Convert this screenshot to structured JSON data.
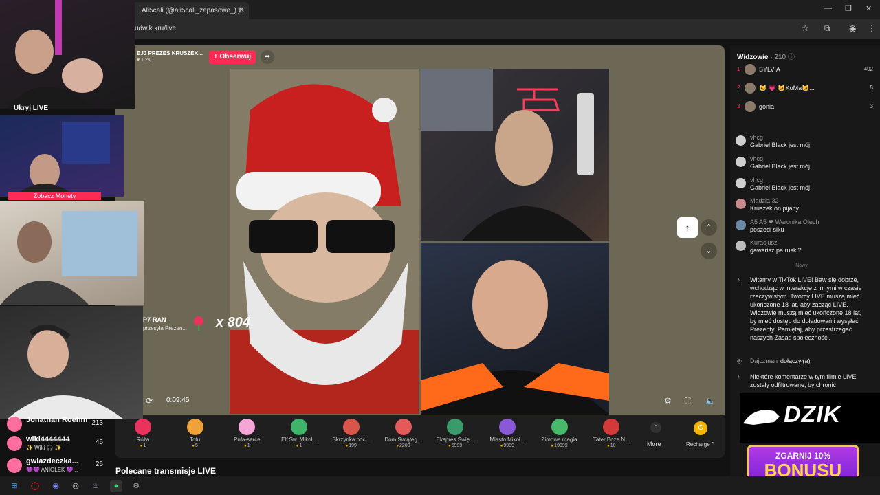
{
  "browser": {
    "tab_title": "Ali5cali (@ali5cali_zapasowe_) j",
    "url": "udwik.kru/live"
  },
  "stream": {
    "host_name": "EJJ PREZES KRUSZEK...",
    "host_likes": "♥ 1.2K",
    "follow_label": "+ Obserwuj",
    "time": "0:09:45",
    "gift_sender": "P7-RAN",
    "gift_sender_sub": "przesyła Prezen...",
    "gift_multiplier": "x 804"
  },
  "gifts": [
    {
      "label": "Róża",
      "price": "1",
      "color": "#e8335c"
    },
    {
      "label": "Tofu",
      "price": "5",
      "color": "#f0a23a"
    },
    {
      "label": "Pufa-serce",
      "price": "1",
      "color": "#f6a6d6"
    },
    {
      "label": "Elf Św. Mikoł...",
      "price": "1",
      "color": "#3fb36a"
    },
    {
      "label": "Skrzynka poc...",
      "price": "199",
      "color": "#d8554a"
    },
    {
      "label": "Dom Świąteg...",
      "price": "2200",
      "color": "#e45a5a"
    },
    {
      "label": "Ekspres Świę...",
      "price": "5999",
      "color": "#3a9a6a"
    },
    {
      "label": "Miasto Mikoł...",
      "price": "9999",
      "color": "#8a5ad6"
    },
    {
      "label": "Zimowa magia",
      "price": "19999",
      "color": "#4ab86a"
    },
    {
      "label": "Tater Boże N...",
      "price": "10",
      "color": "#d23a3a"
    }
  ],
  "gift_more": "More",
  "recharge_label": "Recharge ^",
  "recommended_title": "Polecane transmisje LIVE",
  "viewers": {
    "title": "Widzowie",
    "count": "· 210",
    "top": [
      {
        "rank": "1",
        "name": "SYLVIA",
        "score": "402"
      },
      {
        "rank": "2",
        "name": "🐱 💗 🐱KoMa🐱...",
        "score": "5"
      },
      {
        "rank": "3",
        "name": "gonia",
        "score": "3"
      }
    ]
  },
  "chat": [
    {
      "user": "vhcg",
      "msg": "Gabriel Black jest mój",
      "color": "#cfcfcf"
    },
    {
      "user": "vhcg",
      "msg": "Gabriel Black jest mój",
      "color": "#cfcfcf"
    },
    {
      "user": "vhcg",
      "msg": "Gabriel Black jest mój",
      "color": "#cfcfcf"
    },
    {
      "user": "Madzia 32",
      "msg": "Kruszek on pijany",
      "color": "#c88a8a"
    },
    {
      "user": "A5 A5 ❤ Weronika Olech",
      "msg": "poszedł siku",
      "color": "#6a8aa6"
    },
    {
      "user": "Kuracjusz",
      "msg": "gawarisz pa ruski?",
      "color": "#bdbdbd"
    }
  ],
  "divider_new": "Nowy",
  "system_msg_1": "Witamy w TikTok LIVE! Baw się dobrze, wchodząc w interakcje z innymi w czasie rzeczywistym. Twórcy LIVE muszą mieć ukończone 18 lat, aby zacząć LIVE. Widzowie muszą mieć ukończone 18 lat, by mieć dostęp do doładowań i wysyłać Prezenty. Pamiętaj, aby przestrzegać naszych Zasad społeczności.",
  "join": {
    "user": "Dajczman",
    "action": "dołączył(a)"
  },
  "system_msg_2": "Niektóre komentarze w tym filmie LIVE zostały odfiltrowane, by chronić",
  "ads": {
    "dzik": "DZIK",
    "bonus_line1": "ZGARNIJ 10%",
    "bonus_line2": "BONUSU"
  },
  "overlay": {
    "hide_live": "Ukryj LIVE",
    "zobacz": "Zobacz Monety",
    "leaderboard": [
      {
        "name": "Jonathan Roehm",
        "sub": "",
        "count": "213"
      },
      {
        "name": "wiki4444444",
        "sub": "✨ Wiki 🎧 ✨",
        "count": "45"
      },
      {
        "name": "gwiazdeczka...",
        "sub": "💜💜 ANIOLEK 💜...",
        "count": "26"
      }
    ]
  }
}
